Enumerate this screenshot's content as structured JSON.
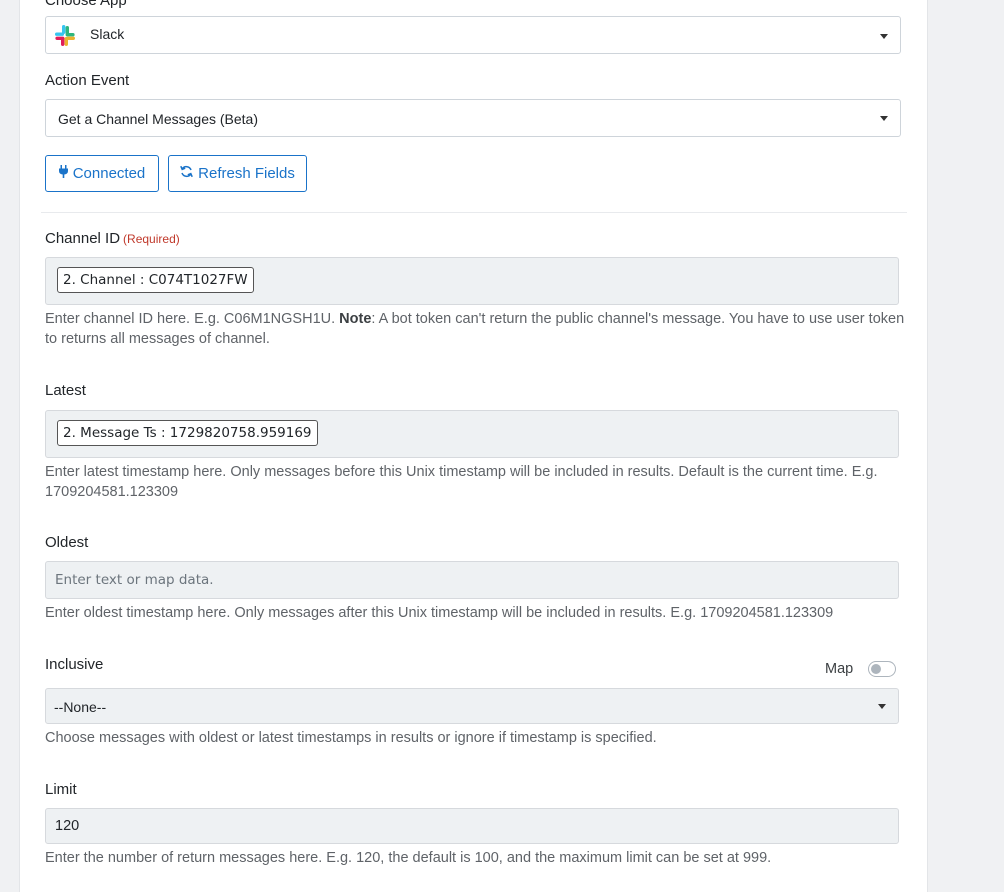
{
  "app_select": {
    "label": "Choose App",
    "value": "Slack",
    "icon": "slack-logo-icon"
  },
  "action_event": {
    "label": "Action Event",
    "value": "Get a Channel Messages (Beta)"
  },
  "buttons": {
    "connected": "Connected",
    "refresh": "Refresh Fields"
  },
  "channel_id": {
    "label": "Channel ID",
    "required": "(Required)",
    "chip": "2. Channel : C074T1027FW",
    "help_pre": "Enter channel ID here. E.g. C06M1NGSH1U. ",
    "help_bold": "Note",
    "help_post": ": A bot token can't return the public channel's message. You have to use user token to returns all messages of channel."
  },
  "latest": {
    "label": "Latest",
    "chip": "2. Message Ts : 1729820758.959169",
    "help": "Enter latest timestamp here. Only messages before this Unix timestamp will be included in results. Default is the current time. E.g. 1709204581.123309"
  },
  "oldest": {
    "label": "Oldest",
    "placeholder": "Enter text or map data.",
    "help": "Enter oldest timestamp here. Only messages after this Unix timestamp will be included in results. E.g. 1709204581.123309"
  },
  "inclusive": {
    "label": "Inclusive",
    "map_label": "Map",
    "map_enabled": false,
    "value": "--None--",
    "help": "Choose messages with oldest or latest timestamps in results or ignore if timestamp is specified."
  },
  "limit": {
    "label": "Limit",
    "value": "120",
    "help": "Enter the number of return messages here. E.g. 120, the default is 100, and the maximum limit can be set at 999."
  },
  "colors": {
    "accent": "#1a73c9",
    "required": "#c0392b",
    "field_bg": "#eef1f3"
  }
}
